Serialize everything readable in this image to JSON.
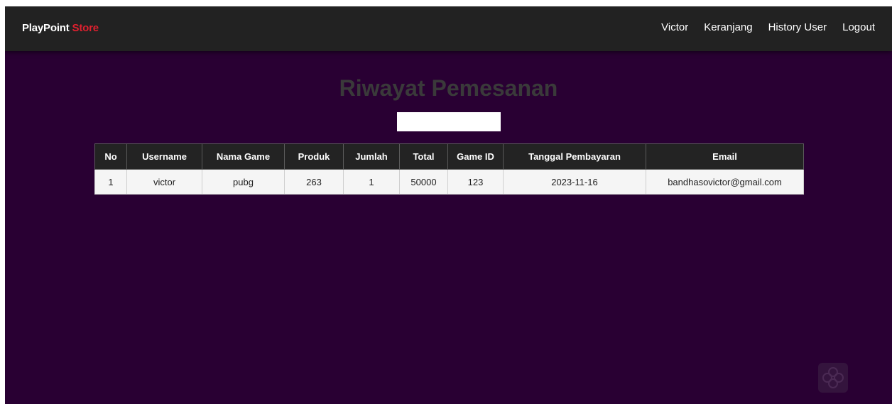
{
  "navbar": {
    "brand_main": "PlayPoint",
    "brand_accent": "Store",
    "links": [
      "Victor",
      "Keranjang",
      "History User",
      "Logout"
    ]
  },
  "page": {
    "title": "Riwayat Pemesanan"
  },
  "search": {
    "value": ""
  },
  "table": {
    "headers": [
      "No",
      "Username",
      "Nama Game",
      "Produk",
      "Jumlah",
      "Total",
      "Game ID",
      "Tanggal Pembayaran",
      "Email"
    ],
    "rows": [
      [
        "1",
        "victor",
        "pubg",
        "263",
        "1",
        "50000",
        "123",
        "2023-11-16",
        "bandhasovictor@gmail.com"
      ]
    ]
  },
  "colors": {
    "background": "#290033",
    "navbar": "#222222",
    "brand_accent": "#e0202f",
    "table_header": "#232323",
    "table_row": "#f5f5f5"
  },
  "icons": {
    "corner": "flower-logo-icon"
  }
}
